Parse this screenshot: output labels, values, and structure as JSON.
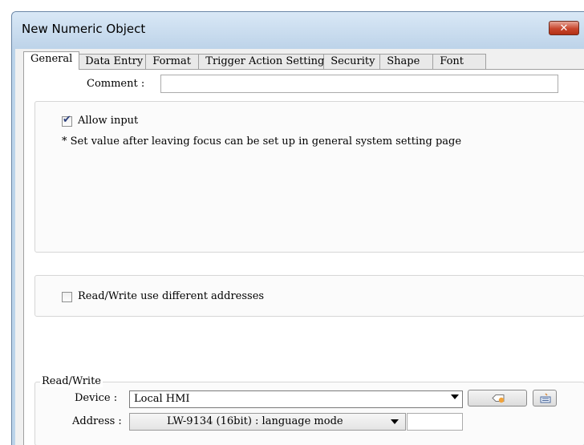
{
  "window": {
    "title": "New Numeric Object",
    "close_glyph": "✕"
  },
  "tabs": [
    {
      "label": "General",
      "active": true
    },
    {
      "label": "Data Entry"
    },
    {
      "label": "Format"
    },
    {
      "label": "Trigger Action Setting"
    },
    {
      "label": "Security"
    },
    {
      "label": "Shape"
    },
    {
      "label": "Font"
    }
  ],
  "general": {
    "comment_label": "Comment :",
    "comment_value": "",
    "allow_input": {
      "label": "Allow input",
      "checked": true
    },
    "note": "* Set value after leaving focus can be set up in general system setting page",
    "different_addresses": {
      "label": "Read/Write use different addresses",
      "checked": false
    },
    "read_write": {
      "legend": "Read/Write",
      "device_label": "Device :",
      "device_value": "Local HMI",
      "address_label": "Address :",
      "address_value": "LW-9134 (16bit) : language mode"
    }
  },
  "icons": [
    "tag-icon",
    "keyboard-icon"
  ],
  "colors": {
    "accent": "#bcd4ea",
    "close": "#c8462d"
  }
}
